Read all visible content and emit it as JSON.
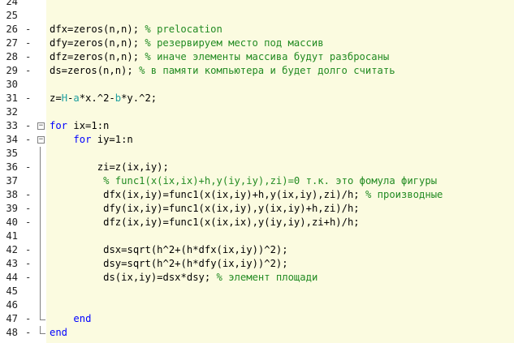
{
  "editor": {
    "lines": [
      {
        "num": "24",
        "indent": 0,
        "tokens": []
      },
      {
        "num": "25",
        "indent": 0,
        "tokens": []
      },
      {
        "num": "26",
        "dash": "-",
        "indent": 0,
        "tokens": [
          {
            "t": "dfx=zeros(n,n); ",
            "c": "t"
          },
          {
            "t": "% prelocation",
            "c": "c"
          }
        ]
      },
      {
        "num": "27",
        "dash": "-",
        "indent": 0,
        "tokens": [
          {
            "t": "dfy=zeros(n,n); ",
            "c": "t"
          },
          {
            "t": "% резервируем место под массив",
            "c": "c"
          }
        ]
      },
      {
        "num": "28",
        "dash": "-",
        "indent": 0,
        "tokens": [
          {
            "t": "dfz=zeros(n,n); ",
            "c": "t"
          },
          {
            "t": "% иначе элементы массива будут разбросаны",
            "c": "c"
          }
        ]
      },
      {
        "num": "29",
        "dash": "-",
        "indent": 0,
        "tokens": [
          {
            "t": "ds=zeros(n,n); ",
            "c": "t"
          },
          {
            "t": "% в памяти компьютера и будет долго считать",
            "c": "c"
          }
        ]
      },
      {
        "num": "30",
        "indent": 0,
        "tokens": []
      },
      {
        "num": "31",
        "dash": "-",
        "indent": 0,
        "tokens": [
          {
            "t": "z=",
            "c": "t"
          },
          {
            "t": "H",
            "c": "v"
          },
          {
            "t": "-",
            "c": "t"
          },
          {
            "t": "a",
            "c": "v"
          },
          {
            "t": "*x.^2-",
            "c": "t"
          },
          {
            "t": "b",
            "c": "v"
          },
          {
            "t": "*y.^2;",
            "c": "t"
          }
        ]
      },
      {
        "num": "32",
        "indent": 0,
        "tokens": []
      },
      {
        "num": "33",
        "dash": "-",
        "fold": "box",
        "indent": 0,
        "tokens": [
          {
            "t": "for",
            "c": "k"
          },
          {
            "t": " ix=1:n",
            "c": "t"
          }
        ]
      },
      {
        "num": "34",
        "dash": "-",
        "fold": "box",
        "indent": 4,
        "tokens": [
          {
            "t": "for",
            "c": "k"
          },
          {
            "t": " iy=1:n",
            "c": "t"
          }
        ]
      },
      {
        "num": "35",
        "fold": "line",
        "indent": 0,
        "tokens": []
      },
      {
        "num": "36",
        "dash": "-",
        "fold": "line",
        "indent": 8,
        "tokens": [
          {
            "t": "zi=z(ix,iy);",
            "c": "t"
          }
        ]
      },
      {
        "num": "37",
        "fold": "line",
        "indent": 8,
        "tokens": [
          {
            "t": " % func1(x(ix,ix)+h,y(iy,iy),zi)=0 т.к. это фомула фигуры",
            "c": "c"
          }
        ]
      },
      {
        "num": "38",
        "dash": "-",
        "fold": "line",
        "indent": 8,
        "tokens": [
          {
            "t": " dfx(ix,iy)=func1(x(ix,iy)+h,y(ix,iy),zi)/h; ",
            "c": "t"
          },
          {
            "t": "% производные",
            "c": "c"
          }
        ]
      },
      {
        "num": "39",
        "dash": "-",
        "fold": "line",
        "indent": 8,
        "tokens": [
          {
            "t": " dfy(ix,iy)=func1(x(ix,iy),y(ix,iy)+h,zi)/h;",
            "c": "t"
          }
        ]
      },
      {
        "num": "40",
        "dash": "-",
        "fold": "line",
        "indent": 8,
        "tokens": [
          {
            "t": " dfz(ix,iy)=func1(x(ix,ix),y(iy,iy),zi+h)/h;",
            "c": "t"
          }
        ]
      },
      {
        "num": "41",
        "fold": "line",
        "indent": 0,
        "tokens": []
      },
      {
        "num": "42",
        "dash": "-",
        "fold": "line",
        "indent": 8,
        "tokens": [
          {
            "t": " dsx=sqrt(h^2+(h*dfx(ix,iy))^2);",
            "c": "t"
          }
        ]
      },
      {
        "num": "43",
        "dash": "-",
        "fold": "line",
        "indent": 8,
        "tokens": [
          {
            "t": " dsy=sqrt(h^2+(h*dfy(ix,iy))^2);",
            "c": "t"
          }
        ]
      },
      {
        "num": "44",
        "dash": "-",
        "fold": "line",
        "indent": 8,
        "tokens": [
          {
            "t": " ds(ix,iy)=dsx*dsy; ",
            "c": "t"
          },
          {
            "t": "% элемент площади",
            "c": "c"
          }
        ]
      },
      {
        "num": "45",
        "fold": "line",
        "indent": 0,
        "tokens": []
      },
      {
        "num": "46",
        "fold": "line",
        "indent": 0,
        "tokens": []
      },
      {
        "num": "47",
        "dash": "-",
        "fold": "end",
        "indent": 4,
        "tokens": [
          {
            "t": "end",
            "c": "k"
          }
        ]
      },
      {
        "num": "48",
        "dash": "-",
        "fold": "end",
        "indent": 0,
        "tokens": [
          {
            "t": "end",
            "c": "k"
          }
        ]
      }
    ]
  },
  "colors": {
    "keyword": "#0000ff",
    "comment": "#228b22",
    "variable": "#20a0a0",
    "code_background": "#fbfbe0"
  }
}
